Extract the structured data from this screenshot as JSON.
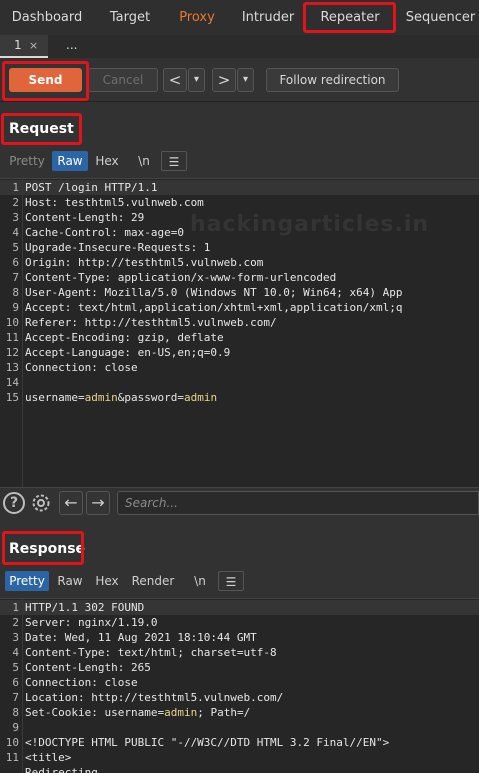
{
  "top_tabs": [
    {
      "label": "Dashboard"
    },
    {
      "label": "Target"
    },
    {
      "label": "Proxy"
    },
    {
      "label": "Intruder"
    },
    {
      "label": "Repeater"
    },
    {
      "label": "Sequencer"
    }
  ],
  "sub_tabs": {
    "tab1_label": "1",
    "close_glyph": "×",
    "more_label": "..."
  },
  "toolbar": {
    "send_label": "Send",
    "cancel_label": "Cancel",
    "back_glyph": "<",
    "forward_glyph": ">",
    "dropdown_glyph": "▾",
    "follow_label": "Follow redirection"
  },
  "request": {
    "title": "Request",
    "view_tabs": {
      "pretty": "Pretty",
      "raw": "Raw",
      "hex": "Hex",
      "newline": "\\n",
      "menu": "☰"
    },
    "lines": [
      {
        "n": "1",
        "text": "POST /login HTTP/1.1"
      },
      {
        "n": "2",
        "text": "Host: testhtml5.vulnweb.com"
      },
      {
        "n": "3",
        "text": "Content-Length: 29"
      },
      {
        "n": "4",
        "text": "Cache-Control: max-age=0"
      },
      {
        "n": "5",
        "text": "Upgrade-Insecure-Requests: 1"
      },
      {
        "n": "6",
        "text": "Origin: http://testhtml5.vulnweb.com"
      },
      {
        "n": "7",
        "text": "Content-Type: application/x-www-form-urlencoded"
      },
      {
        "n": "8",
        "text": "User-Agent: Mozilla/5.0 (Windows NT 10.0; Win64; x64) App"
      },
      {
        "n": "9",
        "text": "Accept: text/html,application/xhtml+xml,application/xml;q"
      },
      {
        "n": "10",
        "text": "Referer: http://testhtml5.vulnweb.com/"
      },
      {
        "n": "11",
        "text": "Accept-Encoding: gzip, deflate"
      },
      {
        "n": "12",
        "text": "Accept-Language: en-US,en;q=0.9"
      },
      {
        "n": "13",
        "text": "Connection: close"
      },
      {
        "n": "14",
        "text": ""
      },
      {
        "n": "15",
        "text": ""
      }
    ],
    "body_params": {
      "k1": "username",
      "eq1": "=",
      "v1": "admin",
      "amp": "&",
      "k2": "password",
      "eq2": "=",
      "v2": "admin"
    }
  },
  "search": {
    "placeholder": "Search...",
    "help_glyph": "?",
    "prev_glyph": "←",
    "next_glyph": "→"
  },
  "response": {
    "title": "Response",
    "view_tabs": {
      "pretty": "Pretty",
      "raw": "Raw",
      "hex": "Hex",
      "render": "Render",
      "newline": "\\n",
      "menu": "☰"
    },
    "lines": [
      {
        "n": "1",
        "text": "HTTP/1.1 302 FOUND"
      },
      {
        "n": "2",
        "text": "Server: nginx/1.19.0"
      },
      {
        "n": "3",
        "text": "Date: Wed, 11 Aug 2021 18:10:44 GMT"
      },
      {
        "n": "4",
        "text": "Content-Type: text/html; charset=utf-8"
      },
      {
        "n": "5",
        "text": "Content-Length: 265"
      },
      {
        "n": "6",
        "text": "Connection: close"
      },
      {
        "n": "7",
        "text": "Location: http://testhtml5.vulnweb.com/"
      },
      {
        "n": "8",
        "text": ""
      },
      {
        "n": "9",
        "text": ""
      },
      {
        "n": "10",
        "text": "<!DOCTYPE HTML PUBLIC \"-//W3C//DTD HTML 3.2 Final//EN\">"
      },
      {
        "n": "11",
        "text": "<title>"
      },
      {
        "n": "",
        "text": "  Redirecting..."
      }
    ],
    "cookie": {
      "prefix": "Set-Cookie: ",
      "key": "username",
      "eq": "=",
      "value": "admin",
      "suffix": "; Path=/"
    }
  },
  "watermark": "hackingarticles.in",
  "colors": {
    "accent_send": "#e0653a",
    "proxy_tab": "#e9782f",
    "active_view_tab": "#2c65a6",
    "highlight_box": "#e3131b"
  }
}
